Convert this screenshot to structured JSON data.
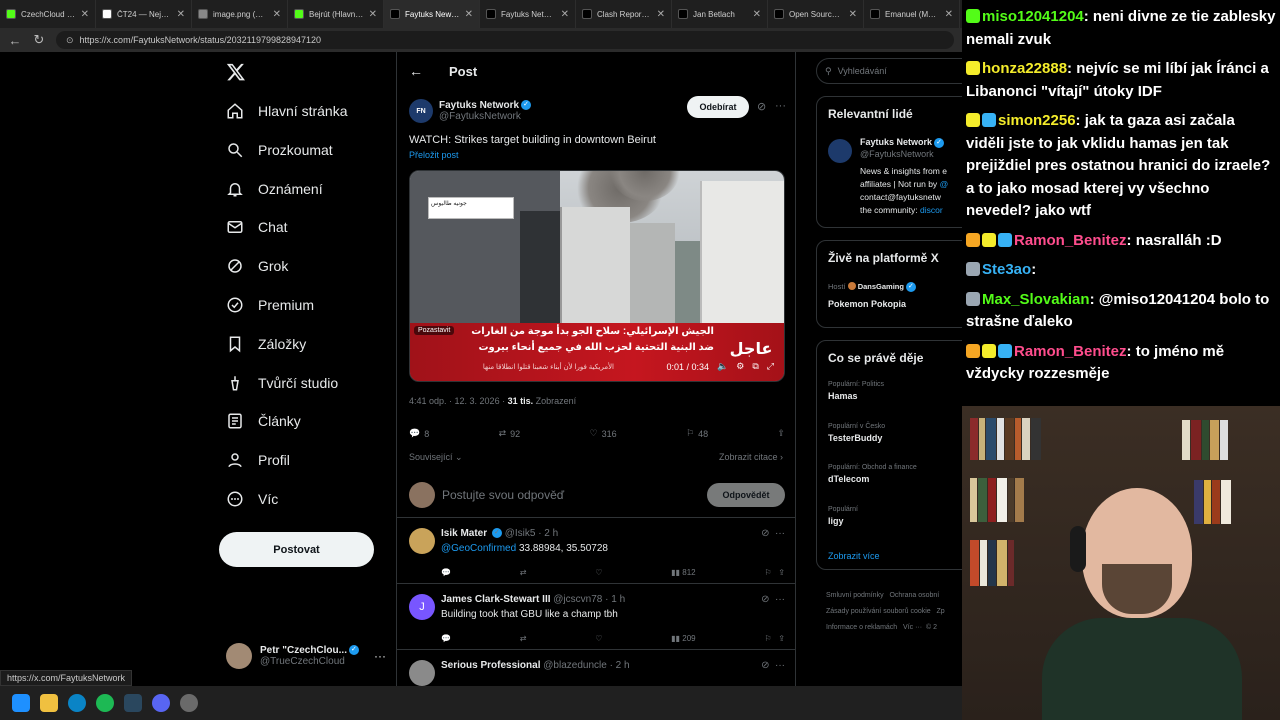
{
  "browser": {
    "tabs": [
      {
        "title": "CzechCloud Str",
        "color": "#53fc18"
      },
      {
        "title": "ČT24 — Nejdův",
        "color": "#ffffff"
      },
      {
        "title": "image.png (125",
        "color": "#888888"
      },
      {
        "title": "Bejrút (Hlavní m",
        "color": "#53fc18"
      },
      {
        "title": "Faytuks News n",
        "color": "#000000"
      },
      {
        "title": "Faytuks Networ",
        "color": "#000000"
      },
      {
        "title": "Clash Report na",
        "color": "#000000"
      },
      {
        "title": "Jan Betlach",
        "color": "#000000"
      },
      {
        "title": "Open Source In",
        "color": "#000000"
      },
      {
        "title": "Emanuel (Mann",
        "color": "#000000"
      }
    ],
    "url": "https://x.com/FaytuksNetwork/status/2032119799828947120",
    "status_url": "https://x.com/FaytuksNetwork"
  },
  "nav": {
    "items": [
      {
        "label": "Hlavní stránka",
        "icon": "home-icon"
      },
      {
        "label": "Prozkoumat",
        "icon": "search-icon"
      },
      {
        "label": "Oznámení",
        "icon": "bell-icon"
      },
      {
        "label": "Chat",
        "icon": "mail-icon"
      },
      {
        "label": "Grok",
        "icon": "grok-icon"
      },
      {
        "label": "Premium",
        "icon": "premium-icon"
      },
      {
        "label": "Záložky",
        "icon": "bookmark-icon"
      },
      {
        "label": "Tvůrčí studio",
        "icon": "studio-icon"
      },
      {
        "label": "Články",
        "icon": "article-icon"
      },
      {
        "label": "Profil",
        "icon": "person-icon"
      },
      {
        "label": "Víc",
        "icon": "more-icon"
      }
    ],
    "post_button": "Postovat",
    "account": {
      "name": "Petr \"CzechClou...",
      "handle": "@TrueCzechCloud"
    }
  },
  "post": {
    "header": "Post",
    "author_name": "Faytuks Network",
    "author_handle": "@FaytuksNetwork",
    "avatar_text": "FN",
    "follow_label": "Odebírat",
    "text": "WATCH: Strikes target building in downtown Beirut",
    "translate": "Přeložit post",
    "video": {
      "pause_label": "Pozastavit",
      "time": "0:01 / 0:34",
      "breaking": "عاجل",
      "tag": "جونيه  طاليوس",
      "ticker1": "الجيش الإسرائيلي: سلاح الجو بدأ موجة من الغارات",
      "ticker2": "ضد البنية التحتية لحزب الله في جميع أنحاء بيروت",
      "ticker3": "الأمريكية فورا لأن أبناء شعبنا قتلوا انطلاقا منها"
    },
    "time": "4:41 odp. · 12. 3. 2026 ·",
    "views_count": "31 tis.",
    "views_label": "Zobrazení",
    "stats": {
      "replies": "8",
      "reposts": "92",
      "likes": "316",
      "bookmarks": "48"
    },
    "related": "Související",
    "quotes": "Zobrazit citace",
    "reply_placeholder": "Postujte svou odpověď",
    "reply_button": "Odpovědět"
  },
  "replies": [
    {
      "name": "Isik Mater",
      "handle": "@Isik5 · 2 h",
      "mention": "@GeoConfirmed",
      "text": " 33.88984, 35.50728",
      "views": "812",
      "avatar": "#c9a35a"
    },
    {
      "name": "James Clark-Stewart III",
      "handle": "@jcscvn78 · 1 h",
      "mention": "",
      "text": "Building took that GBU like a champ tbh",
      "views": "209",
      "avatar": "#7856ff",
      "initial": "J"
    },
    {
      "name": "Serious Professional",
      "handle": "@blazeduncle · 2 h",
      "mention": "",
      "text": "",
      "views": "",
      "avatar": "#8a8a8a"
    }
  ],
  "right": {
    "search_placeholder": "Vyhledávání",
    "relevant_title": "Relevantní lidé",
    "rel_name": "Faytuks Network",
    "rel_handle": "@FaytuksNetwork",
    "rel_bio1": "News & insights from e",
    "rel_bio2": "affiliates | Not run by",
    "rel_bio2_link": "@",
    "rel_bio3": "contact@faytuksnetw",
    "rel_bio4": "the community:",
    "rel_bio4_link": "discor",
    "live_title": "Živě na platformě X",
    "live_host_label": "Hostí",
    "live_host": "DansGaming",
    "live_name": "Pokemon Pokopia",
    "trends_title": "Co se právě děje",
    "trends": [
      {
        "cat": "Populární: Politics",
        "name": "Hamas"
      },
      {
        "cat": "Populární v Česko",
        "name": "TesterBuddy"
      },
      {
        "cat": "Populární: Obchod a finance",
        "name": "dTelecom"
      },
      {
        "cat": "Populární",
        "name": "ligy"
      }
    ],
    "show_more": "Zobrazit více",
    "footer1": "Smluvní podmínky",
    "footer2": "Ochrana osobní",
    "footer3": "Zásady používání souborů cookie",
    "footer4": "Zp",
    "footer5": "Informace o reklamách",
    "footer6": "Víc ···",
    "footer7": "© 2"
  },
  "chat": [
    {
      "user": "miso12041204",
      "color": "#53fc18",
      "badges": [
        "#53fc18"
      ],
      "text": "neni divne ze tie zablesky nemali zvuk"
    },
    {
      "user": "honza22888",
      "color": "#f4ec2b",
      "badges": [
        "#f4ec2b"
      ],
      "text": "nejvíc se mi líbí jak Íránci a Libanonci \"vítají\" útoky IDF"
    },
    {
      "user": "simon2256",
      "color": "#f4ec2b",
      "badges": [
        "#f4ec2b",
        "#37b2f5"
      ],
      "text": "jak ta gaza asi začala viděli jste to jak vklidu hamas jen tak prejiždiel pres ostatnou hranici do izraele? a to jako mosad kterej vy všechno nevedel? jako wtf"
    },
    {
      "user": "Ramon_Benitez",
      "color": "#ff4d8d",
      "badges": [
        "#f5a623",
        "#f4ec2b",
        "#37b2f5"
      ],
      "text": "nasralláh :D"
    },
    {
      "user": "Ste3ao",
      "color": "#37b2f5",
      "badges": [
        "#9aa6b2"
      ],
      "text": ""
    },
    {
      "user": "Max_Slovakian",
      "color": "#53fc18",
      "badges": [
        "#9aa6b2"
      ],
      "text": "@miso12041204 bolo to strašne ďaleko"
    },
    {
      "user": "Ramon_Benitez",
      "color": "#ff4d8d",
      "badges": [
        "#f5a623",
        "#f4ec2b",
        "#37b2f5"
      ],
      "text": "to jméno mě vždycky rozzesměje"
    }
  ]
}
